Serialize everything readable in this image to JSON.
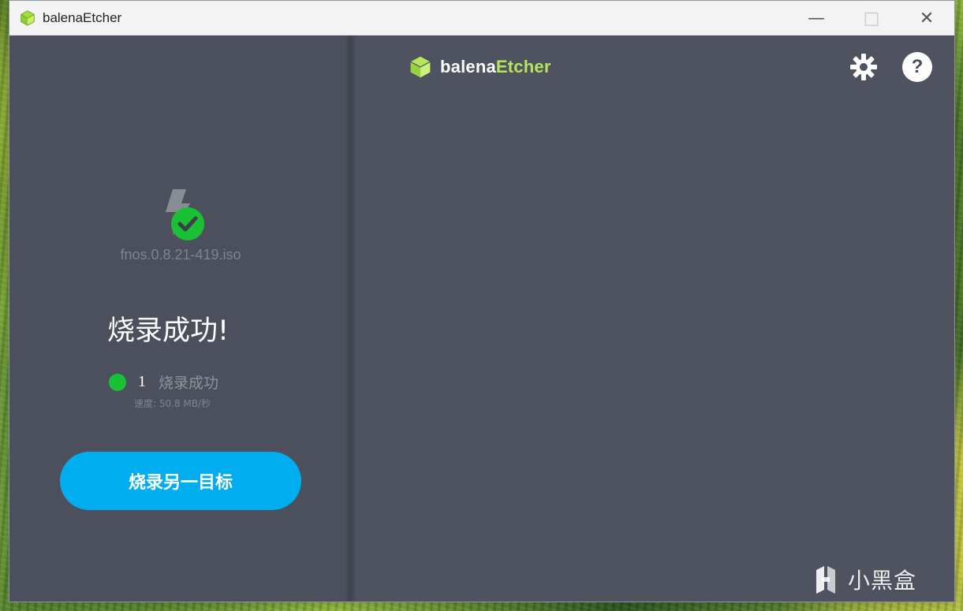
{
  "window": {
    "title": "balenaEtcher"
  },
  "header": {
    "logo_prefix": "balena",
    "logo_suffix": "Etcher",
    "settings_icon": "gear-icon",
    "help_icon": "help-icon",
    "help_label": "?"
  },
  "flash": {
    "filename": "fnos.0.8.21-419.iso",
    "success_title": "烧录成功!",
    "count": "1",
    "status_text": "烧录成功",
    "speed": "速度: 50.8 MB/秒",
    "primary_button": "烧录另一目标"
  },
  "watermark": {
    "text": "小黑盒"
  },
  "colors": {
    "accent_blue": "#00aeef",
    "success_green": "#1ac135",
    "brand_green": "#b6e55b",
    "panel_bg": "#4c505c"
  },
  "icons": {
    "app": "cube-icon",
    "flash": "lightning-icon",
    "success": "check-icon",
    "minimize": "minimize-icon",
    "maximize": "maximize-icon",
    "close": "close-icon"
  }
}
